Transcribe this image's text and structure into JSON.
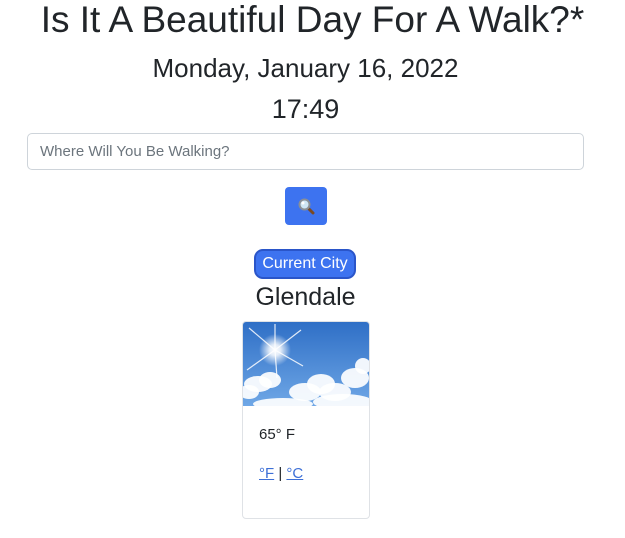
{
  "header": {
    "title": "Is It A Beautiful Day For A Walk?*",
    "date": "Monday, January 16, 2022",
    "time": "17:49"
  },
  "search": {
    "placeholder": "Where Will You Be Walking?",
    "value": "",
    "button_icon": "magnifying-glass-icon"
  },
  "location": {
    "current_city_label": "Current City",
    "city_name": "Glendale"
  },
  "weather": {
    "image": "sunny-sky-icon",
    "temperature": "65° F",
    "unit_f": "°F",
    "separator": "|",
    "unit_c": "°C"
  },
  "colors": {
    "accent": "#3d73f0",
    "link": "#3d6fd6"
  }
}
